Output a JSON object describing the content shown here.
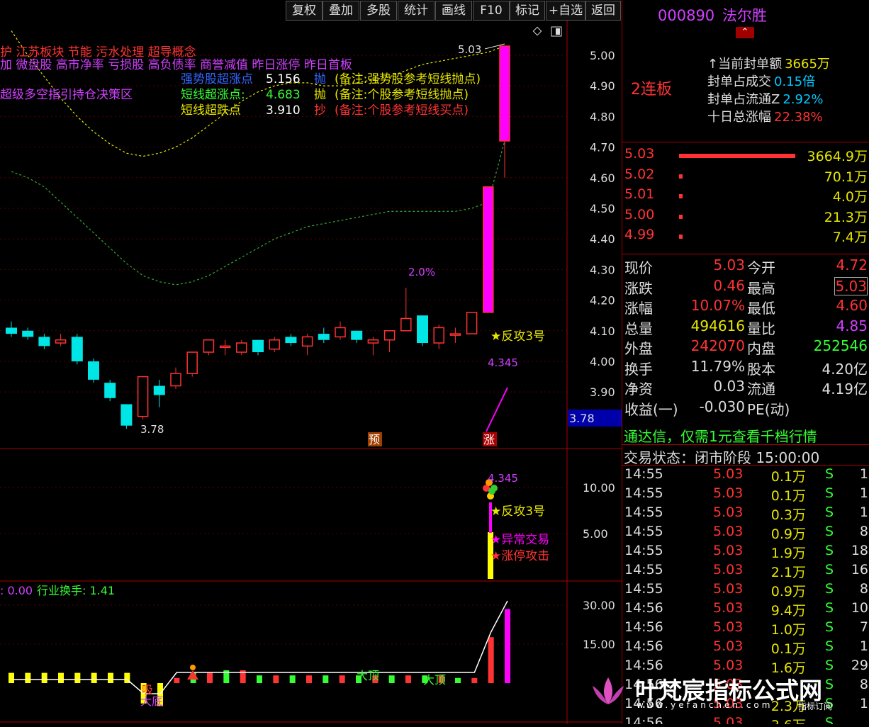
{
  "toolbar": {
    "buttons": [
      "复权",
      "叠加",
      "多股",
      "统计",
      "画线",
      "F10",
      "标记",
      "+自选",
      "返回"
    ]
  },
  "stock": {
    "code": "000890",
    "name": "法尔胜",
    "limit_badge": "2连板",
    "up_arrow_icon": "chevron-up-icon"
  },
  "seal_info": [
    {
      "label": "↑当前封单额",
      "value": "3665万",
      "color": "#e6e600"
    },
    {
      "label": "封单占成交",
      "value": "0.15倍",
      "color": "#00c8ff"
    },
    {
      "label": "封单占流通Z",
      "value": "2.92%",
      "color": "#00c8ff"
    },
    {
      "label": "十日总涨幅",
      "value": "22.38%",
      "color": "#ff3333"
    }
  ],
  "order_book": [
    {
      "price": "5.03",
      "volume": "3664.9万",
      "bar": 1.0
    },
    {
      "price": "5.02",
      "volume": "70.1万",
      "bar": 0.02
    },
    {
      "price": "5.01",
      "volume": "4.0万",
      "bar": 0.01
    },
    {
      "price": "5.00",
      "volume": "21.3万",
      "bar": 0.01
    },
    {
      "price": "4.99",
      "volume": "7.4万",
      "bar": 0.01
    }
  ],
  "quote": [
    {
      "l1": "现价",
      "v1": "5.03",
      "c1": "#ff3333",
      "l2": "今开",
      "v2": "4.72",
      "c2": "#ff3333"
    },
    {
      "l1": "涨跌",
      "v1": "0.46",
      "c1": "#ff3333",
      "l2": "最高",
      "v2": "5.03",
      "c2": "#ff3333"
    },
    {
      "l1": "涨幅",
      "v1": "10.07%",
      "c1": "#ff3333",
      "l2": "最低",
      "v2": "4.60",
      "c2": "#ff3333"
    },
    {
      "l1": "总量",
      "v1": "494616",
      "c1": "#e6e600",
      "l2": "量比",
      "v2": "4.85",
      "c2": "#d040ff"
    },
    {
      "l1": "外盘",
      "v1": "242070",
      "c1": "#ff3333",
      "l2": "内盘",
      "v2": "252546",
      "c2": "#33ff33"
    },
    {
      "l1": "换手",
      "v1": "11.79%",
      "c1": "#dddddd",
      "l2": "股本",
      "v2": "4.20亿",
      "c2": "#dddddd"
    },
    {
      "l1": "净资",
      "v1": "0.03",
      "c1": "#dddddd",
      "l2": "流通",
      "v2": "4.19亿",
      "c2": "#dddddd"
    },
    {
      "l1": "收益(一)",
      "v1": "-0.030",
      "c1": "#dddddd",
      "l2": "PE(动)",
      "v2": "",
      "c2": "#dddddd"
    }
  ],
  "promo": "通达信，仅需1元查看千档行情",
  "trade_status": "交易状态：闭市阶段 15:00:00",
  "ticks": [
    {
      "time": "14:55",
      "price": "5.03",
      "vol": "0.1万",
      "side": "S",
      "n": "1"
    },
    {
      "time": "14:55",
      "price": "5.03",
      "vol": "0.1万",
      "side": "S",
      "n": "1"
    },
    {
      "time": "14:55",
      "price": "5.03",
      "vol": "0.3万",
      "side": "S",
      "n": "1"
    },
    {
      "time": "14:55",
      "price": "5.03",
      "vol": "0.9万",
      "side": "S",
      "n": "8"
    },
    {
      "time": "14:55",
      "price": "5.03",
      "vol": "1.9万",
      "side": "S",
      "n": "18"
    },
    {
      "time": "14:55",
      "price": "5.03",
      "vol": "2.1万",
      "side": "S",
      "n": "16"
    },
    {
      "time": "14:55",
      "price": "5.03",
      "vol": "0.9万",
      "side": "S",
      "n": "8"
    },
    {
      "time": "14:56",
      "price": "5.03",
      "vol": "9.4万",
      "side": "S",
      "n": "10"
    },
    {
      "time": "14:56",
      "price": "5.03",
      "vol": "1.0万",
      "side": "S",
      "n": "7"
    },
    {
      "time": "14:56",
      "price": "5.03",
      "vol": "0.1万",
      "side": "S",
      "n": "1"
    },
    {
      "time": "14:56",
      "price": "5.03",
      "vol": "1.6万",
      "side": "S",
      "n": "29"
    },
    {
      "time": "14:56",
      "price": "5.03",
      "vol": "",
      "side": "S",
      "n": "8"
    },
    {
      "time": "14:56",
      "price": "5.03",
      "vol": "2.3万",
      "side": "S",
      "n": "1"
    },
    {
      "time": "14:56",
      "price": "5.03",
      "vol": "3.6万",
      "side": "S",
      "n": ""
    }
  ],
  "watermark": {
    "title": "叶梵宸指标公式网",
    "url": "www.yefanchen.com",
    "suffix": "指标订阅"
  },
  "main_chart": {
    "concept_line1": "护  江苏板块  节能 污水处理 超导概念",
    "concept_line2": "加 微盘股 高市净率 亏损股 高负债率 商誉减值 昨日涨停 昨日首板",
    "concept_line3": "超级多空指引持仓决策区",
    "signals": [
      {
        "label": "强势股超涨点",
        "value": "5.156",
        "action": "抛",
        "note": "(备注:强势股参考短线抛点)",
        "lc": "#3366ff",
        "vc": "#ffffff",
        "ac": "#3366ff",
        "nc": "#e6e600"
      },
      {
        "label": "短线超涨点:",
        "value": "4.683",
        "action": "抛",
        "note": "(备注:个股参考短线抛点)",
        "lc": "#33ff33",
        "vc": "#33ff33",
        "ac": "#e6e600",
        "nc": "#e6e600"
      },
      {
        "label": "短线超跌点",
        "value": "3.910",
        "action": "抄",
        "note": "(备注:个股参考短线买点)",
        "lc": "#e6e600",
        "vc": "#ffffff",
        "ac": "#ff3333",
        "nc": "#ff3333"
      }
    ],
    "price_ticks": [
      "5.00",
      "4.90",
      "4.80",
      "4.70",
      "4.60",
      "4.50",
      "4.40",
      "4.30",
      "4.20",
      "4.10",
      "4.00",
      "3.90"
    ],
    "price_box": "3.78",
    "high_label": "5.03",
    "low_label": "3.78",
    "pct_label": "2.0%",
    "target_label": "4.345",
    "fangong": "★反攻3号",
    "yu_tag": "预",
    "zhang_tag": "涨"
  },
  "sub1": {
    "ticks": [
      "10.00",
      "5.00"
    ],
    "target": "4.345",
    "fangong": "★反攻3号",
    "yichang": "★异常交易",
    "gongji": "★涨停攻击"
  },
  "sub2": {
    "header_a": ": 0.00",
    "header_b": "行业换手: 1.41",
    "ticks": [
      "30.00",
      "15.00"
    ],
    "xi": "吸",
    "dadi": "大底",
    "dading1": "大顶",
    "dading2": "大顶"
  },
  "chart_data": {
    "type": "candlestick",
    "candles": [
      {
        "o": 4.11,
        "c": 4.09,
        "h": 4.13,
        "l": 4.08
      },
      {
        "o": 4.1,
        "c": 4.08,
        "h": 4.11,
        "l": 4.07
      },
      {
        "o": 4.08,
        "c": 4.05,
        "h": 4.09,
        "l": 4.04
      },
      {
        "o": 4.06,
        "c": 4.07,
        "h": 4.09,
        "l": 4.05
      },
      {
        "o": 4.08,
        "c": 4.0,
        "h": 4.09,
        "l": 3.99
      },
      {
        "o": 4.0,
        "c": 3.94,
        "h": 4.01,
        "l": 3.93
      },
      {
        "o": 3.93,
        "c": 3.88,
        "h": 3.94,
        "l": 3.87
      },
      {
        "o": 3.86,
        "c": 3.79,
        "h": 3.86,
        "l": 3.78
      },
      {
        "o": 3.82,
        "c": 3.95,
        "h": 3.95,
        "l": 3.81
      },
      {
        "o": 3.92,
        "c": 3.89,
        "h": 3.94,
        "l": 3.85
      },
      {
        "o": 3.92,
        "c": 3.96,
        "h": 3.98,
        "l": 3.91
      },
      {
        "o": 3.96,
        "c": 4.03,
        "h": 4.03,
        "l": 3.95
      },
      {
        "o": 4.03,
        "c": 4.07,
        "h": 4.07,
        "l": 4.02
      },
      {
        "o": 4.05,
        "c": 4.05,
        "h": 4.07,
        "l": 4.02
      },
      {
        "o": 4.03,
        "c": 4.06,
        "h": 4.07,
        "l": 4.02
      },
      {
        "o": 4.07,
        "c": 4.03,
        "h": 4.07,
        "l": 4.02
      },
      {
        "o": 4.04,
        "c": 4.07,
        "h": 4.08,
        "l": 4.03
      },
      {
        "o": 4.08,
        "c": 4.06,
        "h": 4.09,
        "l": 4.05
      },
      {
        "o": 4.05,
        "c": 4.08,
        "h": 4.09,
        "l": 4.02
      },
      {
        "o": 4.09,
        "c": 4.07,
        "h": 4.11,
        "l": 4.06
      },
      {
        "o": 4.08,
        "c": 4.11,
        "h": 4.13,
        "l": 4.07
      },
      {
        "o": 4.1,
        "c": 4.07,
        "h": 4.1,
        "l": 4.06
      },
      {
        "o": 4.06,
        "c": 4.07,
        "h": 4.08,
        "l": 4.02
      },
      {
        "o": 4.07,
        "c": 4.1,
        "h": 4.1,
        "l": 4.03
      },
      {
        "o": 4.1,
        "c": 4.14,
        "h": 4.24,
        "l": 4.1
      },
      {
        "o": 4.15,
        "c": 4.06,
        "h": 4.15,
        "l": 4.05
      },
      {
        "o": 4.06,
        "c": 4.11,
        "h": 4.12,
        "l": 4.04
      },
      {
        "o": 4.09,
        "c": 4.09,
        "h": 4.11,
        "l": 4.06
      },
      {
        "o": 4.09,
        "c": 4.16,
        "h": 4.16,
        "l": 4.09
      },
      {
        "o": 4.16,
        "c": 4.57,
        "h": 4.57,
        "l": 4.16
      },
      {
        "o": 4.72,
        "c": 5.03,
        "h": 5.03,
        "l": 4.6
      }
    ],
    "ma_yellow": [
      5.08,
      5.0,
      4.93,
      4.86,
      4.8,
      4.75,
      4.71,
      4.68,
      4.67,
      4.68,
      4.7,
      4.73,
      4.77,
      4.81,
      4.85,
      4.88,
      4.9,
      4.91,
      4.91,
      4.9,
      4.9,
      4.91,
      4.92,
      4.93,
      4.95,
      4.97,
      4.98,
      4.99,
      5.0,
      5.01,
      5.03
    ],
    "ma_green": [
      4.62,
      4.6,
      4.57,
      4.52,
      4.47,
      4.42,
      4.37,
      4.32,
      4.28,
      4.26,
      4.25,
      4.26,
      4.28,
      4.31,
      4.34,
      4.37,
      4.4,
      4.42,
      4.44,
      4.45,
      4.46,
      4.47,
      4.48,
      4.49,
      4.49,
      4.49,
      4.49,
      4.49,
      4.5,
      4.52,
      4.72
    ],
    "yrange": [
      3.78,
      5.03
    ],
    "sub2_bars": [
      4,
      4,
      4,
      4,
      4,
      4,
      4,
      4,
      -8,
      -9,
      2,
      4,
      4,
      5,
      5,
      3,
      3,
      3,
      3,
      3,
      3,
      3,
      3,
      3,
      3,
      3,
      3,
      2,
      2,
      18,
      29
    ]
  }
}
